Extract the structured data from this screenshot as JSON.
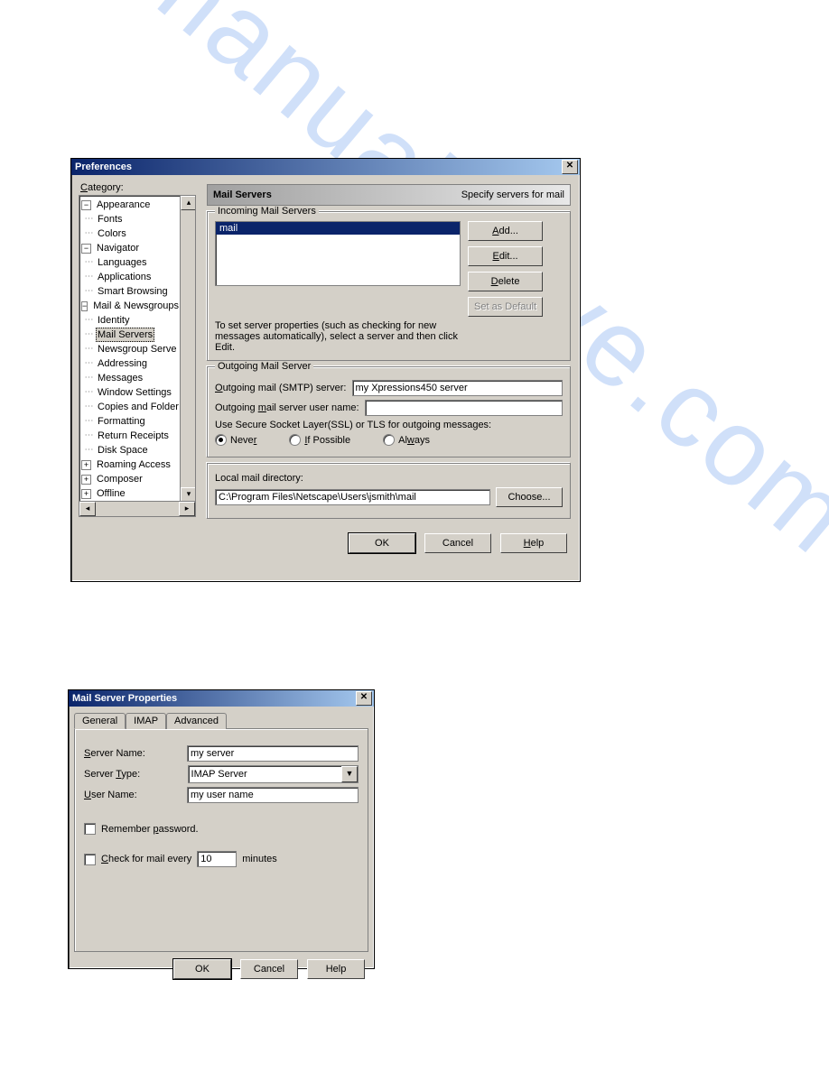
{
  "watermark": "manualshive.com",
  "prefs": {
    "title": "Preferences",
    "category_label": "Category:",
    "tree": {
      "appearance": {
        "label": "Appearance",
        "children": [
          "Fonts",
          "Colors"
        ]
      },
      "navigator": {
        "label": "Navigator",
        "children": [
          "Languages",
          "Applications",
          "Smart Browsing"
        ]
      },
      "mail": {
        "label": "Mail & Newsgroups",
        "children": [
          "Identity",
          "Mail Servers",
          "Newsgroup Serve",
          "Addressing",
          "Messages",
          "Window Settings",
          "Copies and Folder",
          "Formatting",
          "Return Receipts",
          "Disk Space"
        ]
      },
      "roaming": "Roaming Access",
      "composer": "Composer",
      "offline": "Offline"
    },
    "panel": {
      "heading": "Mail Servers",
      "subtitle": "Specify servers for mail"
    },
    "incoming": {
      "legend": "Incoming Mail Servers",
      "list_item": "mail",
      "hint": "To set server properties (such as checking for new messages automatically), select a server and then click Edit.",
      "btn_add": "Add...",
      "btn_edit": "Edit...",
      "btn_delete": "Delete",
      "btn_setdefault": "Set as Default"
    },
    "outgoing": {
      "legend": "Outgoing Mail Server",
      "smtp_label": "Outgoing mail (SMTP) server:",
      "smtp_value": "my Xpressions450 server",
      "user_label": "Outgoing mail server user name:",
      "user_value": "",
      "ssl_label": "Use Secure Socket Layer(SSL) or TLS for outgoing messages:",
      "r_never": "Never",
      "r_ifpossible": "If Possible",
      "r_always": "Always"
    },
    "local": {
      "label": "Local mail directory:",
      "path": "C:\\Program Files\\Netscape\\Users\\jsmith\\mail",
      "choose": "Choose..."
    },
    "buttons": {
      "ok": "OK",
      "cancel": "Cancel",
      "help": "Help"
    }
  },
  "props": {
    "title": "Mail Server Properties",
    "tabs": {
      "general": "General",
      "imap": "IMAP",
      "advanced": "Advanced"
    },
    "server_name_label": "Server Name:",
    "server_name_value": "my server",
    "server_type_label": "Server Type:",
    "server_type_value": "IMAP Server",
    "user_name_label": "User Name:",
    "user_name_value": "my user name",
    "remember": "Remember password.",
    "check_every_pre": "Check for mail every",
    "check_every_post": "minutes",
    "check_value": "10",
    "buttons": {
      "ok": "OK",
      "cancel": "Cancel",
      "help": "Help"
    }
  }
}
